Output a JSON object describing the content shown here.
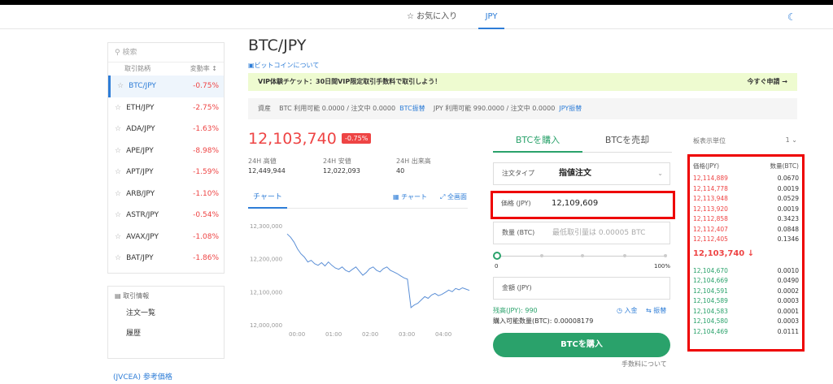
{
  "nav": {
    "favorites": "☆ お気に入り",
    "jpy": "JPY"
  },
  "sidebar": {
    "search_placeholder": "検索",
    "col_pair": "取引銘柄",
    "col_change": "変動率",
    "items": [
      {
        "pair": "BTC/JPY",
        "change": "-0.75%"
      },
      {
        "pair": "ETH/JPY",
        "change": "-2.75%"
      },
      {
        "pair": "ADA/JPY",
        "change": "-1.63%"
      },
      {
        "pair": "APE/JPY",
        "change": "-8.98%"
      },
      {
        "pair": "APT/JPY",
        "change": "-1.59%"
      },
      {
        "pair": "ARB/JPY",
        "change": "-1.10%"
      },
      {
        "pair": "ASTR/JPY",
        "change": "-0.54%"
      },
      {
        "pair": "AVAX/JPY",
        "change": "-1.08%"
      },
      {
        "pair": "BAT/JPY",
        "change": "-1.86%"
      }
    ],
    "info_title": "取引情報",
    "info_links": [
      "注文一覧",
      "履歴"
    ],
    "jvcea": "(JVCEA) 参考価格"
  },
  "main": {
    "title": "BTC/JPY",
    "about": "ビットコインについて",
    "vip_text": "VIP体験チケット：30日間VIP限定取引手数料で取引しよう！",
    "vip_cta": "今すぐ申請 →",
    "assets_label": "資産",
    "assets_btc": "BTC  利用可能 0.0000 / 注文中 0.0000",
    "assets_btc_link": "BTC振替",
    "assets_jpy": "JPY  利用可能 990.0000 / 注文中 0.0000",
    "assets_jpy_link": "JPY振替",
    "price": "12,103,740",
    "price_change": "-0.75%",
    "high_label": "24H 高値",
    "high": "12,449,944",
    "low_label": "24H 安値",
    "low": "12,022,093",
    "vol_label": "24H 出来高",
    "vol": "40",
    "chart_tab": "チャート",
    "chart_btn": "チャート",
    "fullscreen_btn": "全画面"
  },
  "chart_data": {
    "type": "line",
    "x_ticks": [
      "00:00",
      "01:00",
      "02:00",
      "03:00",
      "04:00"
    ],
    "y_ticks": [
      "12,300,000",
      "12,200,000",
      "12,100,000",
      "12,000,000"
    ],
    "ylim": [
      12000000,
      12300000
    ],
    "color": "#5b8fd6",
    "series": [
      {
        "values": [
          12275000,
          12265000,
          12250000,
          12230000,
          12215000,
          12205000,
          12190000,
          12195000,
          12185000,
          12180000,
          12188000,
          12178000,
          12190000,
          12180000,
          12172000,
          12168000,
          12175000,
          12165000,
          12160000,
          12168000,
          12175000,
          12162000,
          12150000,
          12158000,
          12170000,
          12175000,
          12165000,
          12160000,
          12170000,
          12175000,
          12165000,
          12160000,
          12155000,
          12148000,
          12142000,
          12138000,
          12052000,
          12060000,
          12065000,
          12075000,
          12085000,
          12080000,
          12090000,
          12095000,
          12088000,
          12092000,
          12098000,
          12105000,
          12100000,
          12110000,
          12106000,
          12112000,
          12108000,
          12104000
        ]
      }
    ]
  },
  "order": {
    "buy_tab": "BTCを購入",
    "sell_tab": "BTCを売却",
    "type_label": "注文タイプ",
    "type_value": "指値注文",
    "price_label": "価格 (JPY)",
    "price_value": "12,109,609",
    "qty_label": "数量 (BTC)",
    "qty_placeholder": "最低取引量は 0.00005 BTC",
    "slider_min": "0",
    "slider_max": "100%",
    "amount_label": "金額 (JPY)",
    "balance": "残高(JPY): 990",
    "buyable": "購入可能数量(BTC): 0.00008179",
    "deposit": "入金",
    "transfer": "振替",
    "buy_button": "BTCを購入",
    "fee_link": "手数料について"
  },
  "orderbook": {
    "unit_label": "板表示単位",
    "unit_value": "1",
    "price_col": "価格(JPY)",
    "qty_col": "数量(BTC)",
    "asks": [
      {
        "price": "12,114,889",
        "qty": "0.0670"
      },
      {
        "price": "12,114,778",
        "qty": "0.0019"
      },
      {
        "price": "12,113,948",
        "qty": "0.0529"
      },
      {
        "price": "12,113,920",
        "qty": "0.0019"
      },
      {
        "price": "12,112,858",
        "qty": "0.3423"
      },
      {
        "price": "12,112,407",
        "qty": "0.0848"
      },
      {
        "price": "12,112,405",
        "qty": "0.1346"
      }
    ],
    "last": "12,103,740 ↓",
    "bids": [
      {
        "price": "12,104,670",
        "qty": "0.0010"
      },
      {
        "price": "12,104,669",
        "qty": "0.0490"
      },
      {
        "price": "12,104,591",
        "qty": "0.0002"
      },
      {
        "price": "12,104,589",
        "qty": "0.0003"
      },
      {
        "price": "12,104,583",
        "qty": "0.0001"
      },
      {
        "price": "12,104,580",
        "qty": "0.0003"
      },
      {
        "price": "12,104,469",
        "qty": "0.0111"
      }
    ]
  }
}
